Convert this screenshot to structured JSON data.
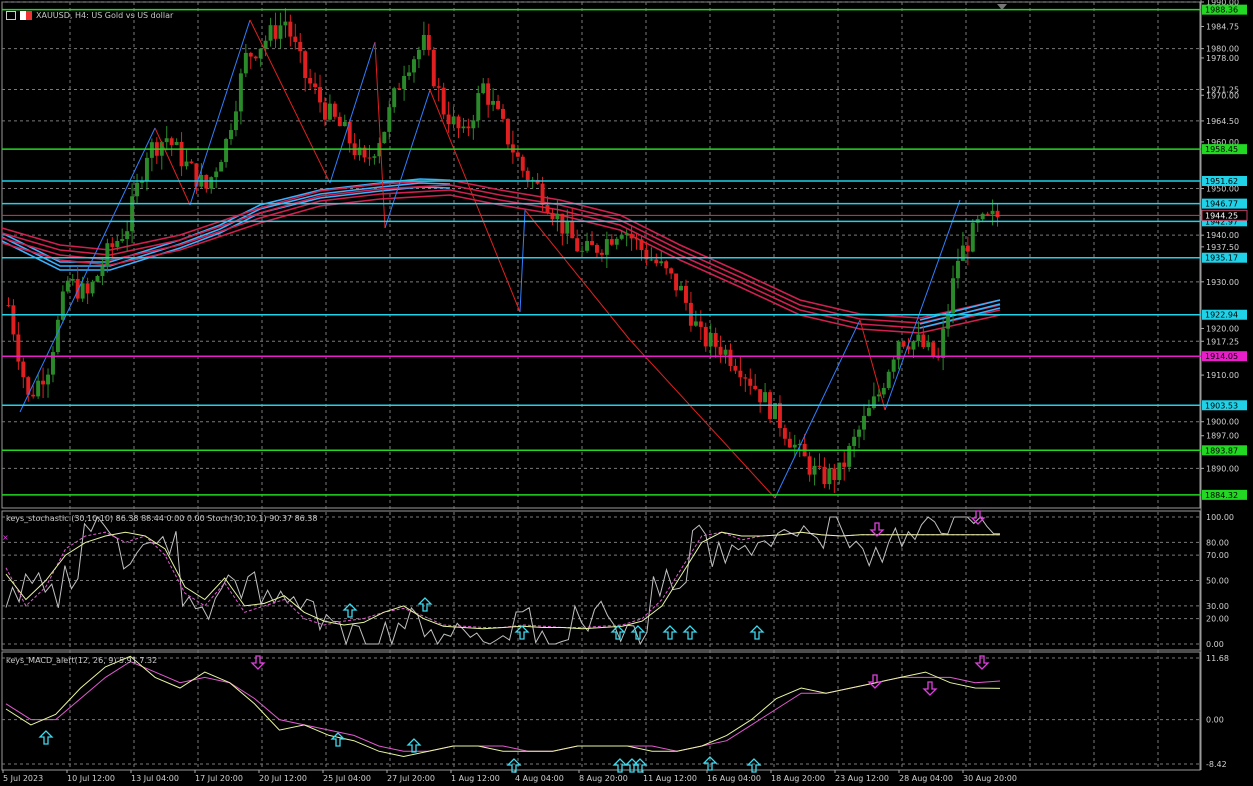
{
  "header": {
    "symbol": "XAUUSD",
    "timeframe": "H4",
    "description": "US Gold vs US dollar",
    "title": "XAUUSD, H4: US Gold vs US dollar"
  },
  "indicators": {
    "stochastic_label": "keys_stochastic (30,10,10) 86.38 88.44 0.00 0.00 Stoch(30,10,1) 90.37 86.38",
    "macd_label": "keys_MACD_alert(12, 26, 9) 5.91 7.32"
  },
  "price_scale": {
    "ticks": [
      "1990.00",
      "1984.75",
      "1980.00",
      "1978.00",
      "1971.25",
      "1970.00",
      "1964.50",
      "1960.00",
      "1950.00",
      "1944.25",
      "1940.00",
      "1937.50",
      "1930.00",
      "1920.00",
      "1917.25",
      "1910.00",
      "1900.00",
      "1897.00",
      "1890.00"
    ],
    "range": [
      1881.5,
      1990
    ]
  },
  "levels": [
    {
      "value": "1988.36",
      "price": 1988.36,
      "color": "#22d822"
    },
    {
      "value": "1958.45",
      "price": 1958.45,
      "color": "#22d822"
    },
    {
      "value": "1951.62",
      "price": 1951.62,
      "color": "#1fd2e8"
    },
    {
      "value": "1946.77",
      "price": 1946.77,
      "color": "#1fd2e8"
    },
    {
      "value": "1942.97",
      "price": 1942.97,
      "color": "#1fd2e8"
    },
    {
      "value": "1935.17",
      "price": 1935.17,
      "color": "#1fd2e8"
    },
    {
      "value": "1922.94",
      "price": 1922.94,
      "color": "#1fd2e8"
    },
    {
      "value": "1914.05",
      "price": 1914.05,
      "color": "#e81ec8"
    },
    {
      "value": "1903.53",
      "price": 1903.53,
      "color": "#1fd2e8"
    },
    {
      "value": "1893.87",
      "price": 1893.87,
      "color": "#22d822"
    },
    {
      "value": "1884.32",
      "price": 1884.32,
      "color": "#22d822"
    }
  ],
  "current_price": {
    "value": "1944.25",
    "price": 1944.25
  },
  "stoch_scale": {
    "ticks": [
      "100.00",
      "80.00",
      "70.00",
      "50.00",
      "30.00",
      "20.00",
      "0.00"
    ],
    "values": [
      100,
      80,
      70,
      50,
      30,
      20,
      0
    ]
  },
  "macd_scale": {
    "ticks": [
      "11.68",
      "0.00",
      "-8.42"
    ],
    "values": [
      11.68,
      0,
      -8.42
    ]
  },
  "time_axis": [
    "5 Jul 2023",
    "10 Jul 12:00",
    "13 Jul 04:00",
    "17 Jul 20:00",
    "20 Jul 12:00",
    "25 Jul 04:00",
    "27 Jul 20:00",
    "1 Aug 12:00",
    "4 Aug 04:00",
    "8 Aug 20:00",
    "11 Aug 12:00",
    "16 Aug 04:00",
    "18 Aug 20:00",
    "23 Aug 12:00",
    "28 Aug 04:00",
    "30 Aug 20:00"
  ],
  "colors": {
    "background": "#000000",
    "grid": "#7a7a7a",
    "bull": "#2a8a2a",
    "bear": "#e02020",
    "ma_blue": "#3ab0ff",
    "ma_red": "#d02050",
    "zigzag_blue": "#2f7fff",
    "zigzag_red": "#e02020",
    "stoch_main": "#e8f5a0",
    "stoch_signal": "#e05ad0",
    "stoch_raw": "#c0c0c0",
    "macd_main": "#e8f5a0",
    "macd_signal": "#e05ad0",
    "arrow_up": "#3fd8ec",
    "arrow_down": "#e040e0",
    "axis_text": "#d0d0d0"
  },
  "chart_data": [
    {
      "type": "candlestick",
      "title": "XAUUSD, H4: US Gold vs US dollar",
      "y_range": [
        1881.5,
        1990
      ],
      "close_path": [
        [
          0,
          1925
        ],
        [
          1,
          1905
        ],
        [
          2,
          1912
        ],
        [
          3,
          1930
        ],
        [
          4,
          1927
        ],
        [
          5,
          1936
        ],
        [
          6,
          1942
        ],
        [
          7,
          1958
        ],
        [
          8,
          1961
        ],
        [
          9,
          1955
        ],
        [
          10,
          1950
        ],
        [
          11,
          1960
        ],
        [
          12,
          1978
        ],
        [
          13,
          1982
        ],
        [
          14,
          1986
        ],
        [
          15,
          1974
        ],
        [
          16,
          1967
        ],
        [
          17,
          1962
        ],
        [
          18,
          1955
        ],
        [
          19,
          1963
        ],
        [
          20,
          1976
        ],
        [
          21,
          1981
        ],
        [
          22,
          1967
        ],
        [
          23,
          1961
        ],
        [
          24,
          1972
        ],
        [
          25,
          1963
        ],
        [
          26,
          1954
        ],
        [
          27,
          1949
        ],
        [
          28,
          1942
        ],
        [
          29,
          1936
        ],
        [
          30,
          1938
        ],
        [
          31,
          1942
        ],
        [
          32,
          1937
        ],
        [
          33,
          1933
        ],
        [
          34,
          1928
        ],
        [
          35,
          1918
        ],
        [
          36,
          1916
        ],
        [
          37,
          1912
        ],
        [
          38,
          1906
        ],
        [
          39,
          1900
        ],
        [
          40,
          1893
        ],
        [
          41,
          1888
        ],
        [
          42,
          1889
        ],
        [
          43,
          1898
        ],
        [
          44,
          1906
        ],
        [
          45,
          1918
        ],
        [
          46,
          1917
        ],
        [
          47,
          1913
        ],
        [
          48,
          1935
        ],
        [
          49,
          1942
        ],
        [
          50,
          1944
        ]
      ]
    },
    {
      "type": "line",
      "title": "keys_stochastic (30,10,10)",
      "y_range": [
        0,
        100
      ],
      "series": [
        {
          "name": "keys_stochastic",
          "values": [
            60,
            30,
            45,
            75,
            85,
            88,
            80,
            85,
            70,
            40,
            30,
            48,
            25,
            30,
            35,
            20,
            15,
            18,
            20,
            25,
            28,
            22,
            15,
            14,
            13,
            13,
            15,
            14,
            13,
            13,
            14,
            15,
            20,
            35,
            60,
            85,
            88,
            82,
            85,
            86,
            88,
            86,
            85,
            86,
            86,
            86,
            86,
            86,
            86,
            86,
            86
          ]
        },
        {
          "name": "Stoch",
          "values": [
            55,
            35,
            50,
            70,
            80,
            85,
            88,
            85,
            75,
            45,
            35,
            52,
            30,
            32,
            38,
            25,
            18,
            15,
            17,
            25,
            30,
            20,
            14,
            13,
            12,
            13,
            14,
            13,
            13,
            12,
            13,
            14,
            18,
            30,
            55,
            80,
            88,
            85,
            85,
            86,
            88,
            86,
            85,
            86,
            86,
            86,
            86,
            86,
            86,
            86,
            86
          ]
        }
      ]
    },
    {
      "type": "line",
      "title": "keys_MACD_alert(12, 26, 9)",
      "y_range": [
        -8.42,
        11.68
      ],
      "series": [
        {
          "name": "MACD",
          "values": [
            2,
            -1,
            1,
            6,
            10,
            12,
            8,
            6,
            9,
            7,
            3,
            -2,
            -1,
            -3,
            -4,
            -6,
            -7,
            -6,
            -5,
            -5,
            -6,
            -6,
            -6,
            -5,
            -5,
            -5,
            -6,
            -6,
            -5,
            -3,
            0,
            4,
            6,
            5,
            6,
            7,
            8,
            9,
            7,
            6,
            5.91
          ]
        },
        {
          "name": "Signal",
          "values": [
            3,
            0,
            0,
            4,
            8,
            11,
            9,
            7,
            8,
            7,
            4,
            0,
            -1,
            -2,
            -3,
            -5,
            -6,
            -6,
            -5,
            -5,
            -5,
            -6,
            -6,
            -5,
            -5,
            -5,
            -5,
            -6,
            -5,
            -4,
            -1,
            2,
            5,
            5,
            6,
            7,
            8,
            8,
            8,
            7,
            7.32
          ]
        }
      ]
    }
  ]
}
